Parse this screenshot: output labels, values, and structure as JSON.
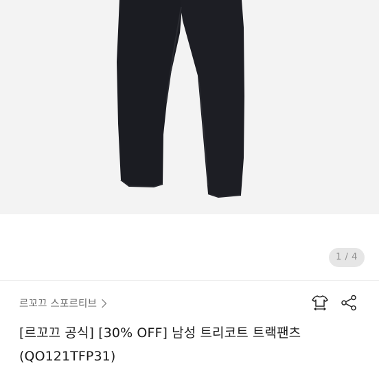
{
  "gallery": {
    "current_page": "1",
    "total_pages": "4",
    "pager_text": "1 / 4",
    "background_color": "#f3f3f3",
    "product_color": "#1b1c22"
  },
  "brand": {
    "name": "르꼬끄 스포르티브",
    "chevron_icon": "chevron-right-icon"
  },
  "actions": {
    "size_icon": "tshirt-size-icon",
    "share_icon": "share-icon"
  },
  "product": {
    "title_line1": "[르꼬끄 공식] [30% OFF] 남성 트리코트 트랙팬츠",
    "title_line2": "(QO121TFP31)"
  }
}
